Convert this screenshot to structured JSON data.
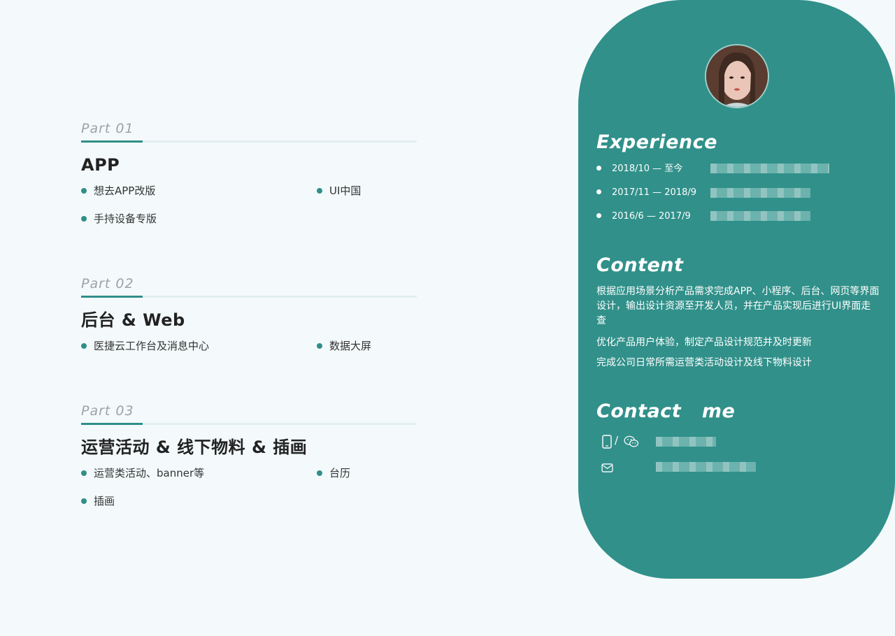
{
  "parts": [
    {
      "label": "Part  01",
      "title": "APP",
      "items": [
        "想去APP改版",
        "UI中国",
        "手持设备专版"
      ]
    },
    {
      "label": "Part  02",
      "title": "后台  &  Web",
      "items": [
        "医捷云工作台及消息中心",
        "数据大屏"
      ]
    },
    {
      "label": "Part  03",
      "title": "运营活动 & 线下物料 & 插画",
      "items": [
        "运营类活动、banner等",
        "台历",
        "插画"
      ]
    }
  ],
  "panel": {
    "experience_title": "Experience",
    "experience": [
      {
        "date": "2018/10 — 至今"
      },
      {
        "date": "2017/11 — 2018/9"
      },
      {
        "date": "2016/6 — 2017/9"
      }
    ],
    "content_title": "Content",
    "content": [
      "根据应用场景分析产品需求完成APP、小程序、后台、网页等界面设计，输出设计资源至开发人员，并在产品实现后进行UI界面走查",
      "优化产品用户体验，制定产品设计规范并及时更新",
      "完成公司日常所需运营类活动设计及线下物料设计"
    ],
    "contact_title": "Contact   me",
    "contact_separator": "/",
    "contact_icons": [
      "phone-icon",
      "wechat-icon",
      "mail-icon"
    ]
  },
  "colors": {
    "accent": "#2f8f88",
    "panel": "#31908a",
    "background": "#f4fafb"
  }
}
